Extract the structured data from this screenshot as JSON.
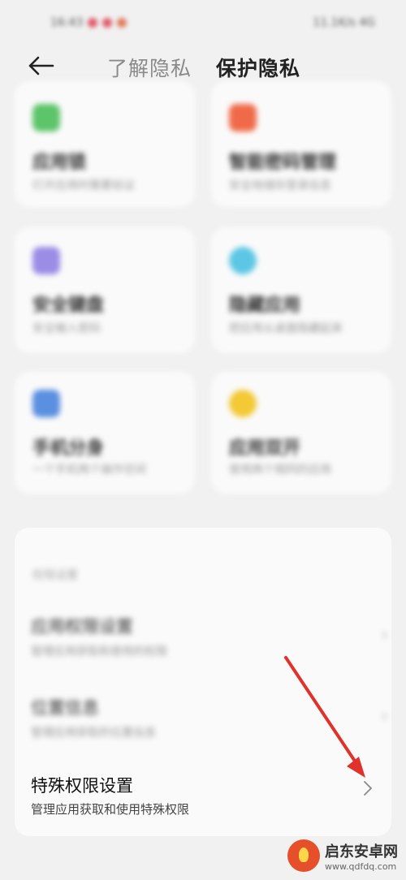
{
  "status": {
    "time": "16:43",
    "right": "11.1K/s 4G"
  },
  "header": {
    "tab_learn": "了解隐私",
    "tab_protect": "保护隐私"
  },
  "cards": [
    {
      "title": "应用锁",
      "sub": "打开应用时需要验证",
      "icon": "lock-app-icon",
      "color": "#5dc46a"
    },
    {
      "title": "智能密码管理",
      "sub": "安全地储存登录信息",
      "icon": "password-icon",
      "color": "#f06a4a"
    },
    {
      "title": "安全键盘",
      "sub": "安全输入密码",
      "icon": "keyboard-icon",
      "color": "#9b8ce6"
    },
    {
      "title": "隐藏应用",
      "sub": "把应用从桌面隐藏起来",
      "icon": "hide-app-icon",
      "color": "#5cc7e5"
    },
    {
      "title": "手机分身",
      "sub": "一个手机两个操作空间",
      "icon": "clone-icon",
      "color": "#5b8fe0"
    },
    {
      "title": "应用双开",
      "sub": "使用两个相同的应用",
      "icon": "dual-app-icon",
      "color": "#f3c934"
    }
  ],
  "permissions": {
    "section_title": "权限设置",
    "rows": [
      {
        "title": "应用权限设置",
        "sub": "管理应用获取和使用的权限"
      },
      {
        "title": "位置信息",
        "sub": "管理应用获取的位置信息"
      }
    ],
    "special": {
      "title": "特殊权限设置",
      "sub": "管理应用获取和使用特殊权限"
    }
  },
  "watermark": {
    "name": "启东安卓网",
    "url": "www.qdfdq.com"
  }
}
